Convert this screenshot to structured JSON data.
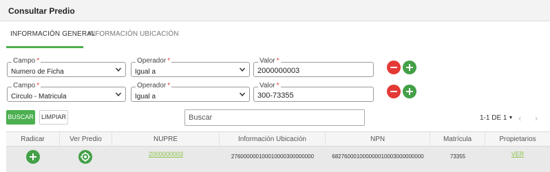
{
  "header": {
    "title": "Consultar Predio"
  },
  "tabs": [
    {
      "label": "INFORMACIÓN GENERAL"
    },
    {
      "label": "INFORMACIÓN UBICACIÓN"
    }
  ],
  "filters": [
    {
      "campo_label": "Campo",
      "campo_value": "Numero de Ficha",
      "operador_label": "Operador",
      "operador_value": "Igual a",
      "valor_label": "Valor",
      "valor_value": "2000000003",
      "required_mark": "*"
    },
    {
      "campo_label": "Campo",
      "campo_value": "Circulo - Matricula",
      "operador_label": "Operador",
      "operador_value": "Igual a",
      "valor_label": "Valor",
      "valor_value": "300-73355",
      "required_mark": "*"
    }
  ],
  "toolbar": {
    "buscar_label": "BUSCAR",
    "limpiar_label": "LIMPIAR",
    "search_placeholder": "Buscar",
    "pagination": "1-1 DE 1",
    "pagination_caret": "▼",
    "prev_arrow": "‹",
    "next_arrow": "›"
  },
  "table": {
    "columns": [
      "Radicar",
      "Ver Predio",
      "NUPRE",
      "Información Ubicación",
      "NPN",
      "Matrícula",
      "Propietarios"
    ],
    "rows": [
      {
        "nupre": "2000000003",
        "ubicacion": "276000000100010000300000000",
        "npn": "682760001000000010003000000000",
        "matricula": "73355",
        "propietarios": "VER"
      }
    ]
  },
  "colors": {
    "accent_green": "#4caf50",
    "danger_red": "#e53935",
    "link_green": "#8bc34a"
  },
  "icons": {
    "remove": "minus-icon",
    "add": "plus-icon",
    "dropdown": "chevron-down-icon",
    "radicar": "plus-icon",
    "ver_predio": "target-icon"
  }
}
